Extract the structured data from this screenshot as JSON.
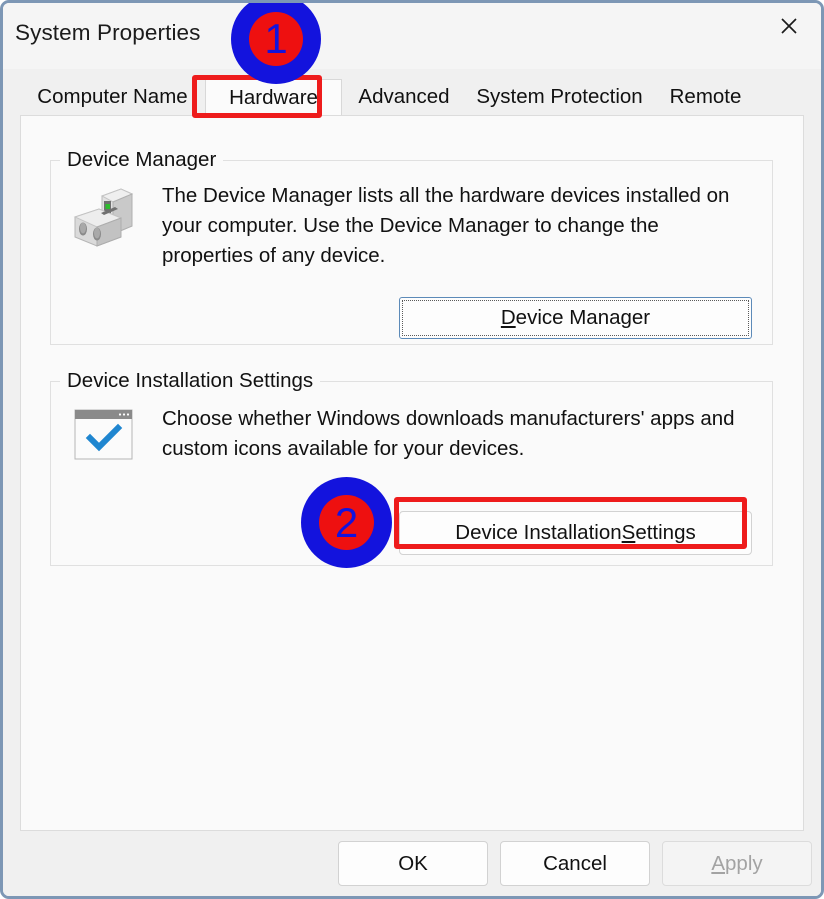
{
  "window": {
    "title": "System Properties",
    "close_icon": "close-icon",
    "border_color": "#7d97b5"
  },
  "tabs": [
    {
      "label": "Computer Name",
      "selected": false
    },
    {
      "label": "Hardware",
      "selected": true
    },
    {
      "label": "Advanced",
      "selected": false
    },
    {
      "label": "System Protection",
      "selected": false
    },
    {
      "label": "Remote",
      "selected": false
    }
  ],
  "groups": [
    {
      "title": "Device Manager",
      "icon": "device-manager-icon",
      "description": "The Device Manager lists all the hardware devices installed on your computer. Use the Device Manager to change the properties of any device.",
      "button": {
        "label": "Device Manager",
        "accel": "D",
        "label_before": "",
        "label_after": "evice Manager",
        "focused": true,
        "disabled": false
      }
    },
    {
      "title": "Device Installation Settings",
      "icon": "device-installation-check-icon",
      "description": "Choose whether Windows downloads manufacturers' apps and custom icons available for your devices.",
      "button": {
        "label": "Device Installation Settings",
        "accel": "S",
        "label_before": "Device Installation ",
        "label_after": "ettings",
        "focused": false,
        "disabled": false
      }
    }
  ],
  "footer": {
    "buttons": [
      {
        "label": "OK",
        "label_before": "OK",
        "accel": "",
        "label_after": "",
        "disabled": false
      },
      {
        "label": "Cancel",
        "label_before": "Cancel",
        "accel": "",
        "label_after": "",
        "disabled": false
      },
      {
        "label": "Apply",
        "label_before": "",
        "accel": "A",
        "label_after": "pply",
        "disabled": true
      }
    ]
  },
  "annotations": {
    "badges": [
      {
        "number": "1",
        "target": "hardware-tab"
      },
      {
        "number": "2",
        "target": "device-installation-settings-button"
      }
    ],
    "highlight_color": "#ee1c1c",
    "badge_ring_color": "#1313dd",
    "badge_fill_color": "#ee1010",
    "highlights": [
      {
        "target": "hardware-tab"
      },
      {
        "target": "device-installation-settings-button"
      }
    ]
  }
}
